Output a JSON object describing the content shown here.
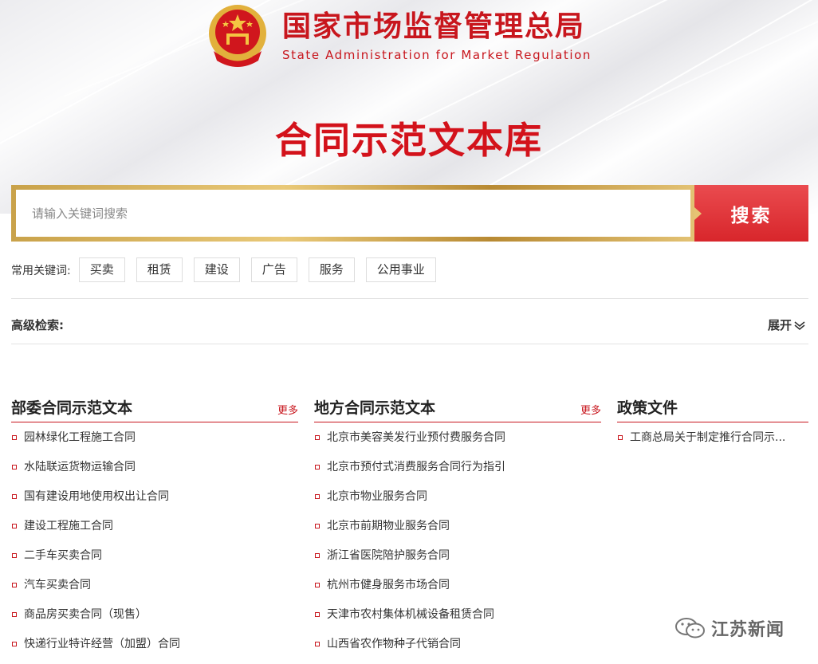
{
  "header": {
    "org_name_cn": "国家市场监督管理总局",
    "org_name_en": "State Administration for Market Regulation",
    "page_title": "合同示范文本库"
  },
  "search": {
    "placeholder": "请输入关键词搜索",
    "button_label": "搜索"
  },
  "keywords": {
    "label": "常用关键词:",
    "tags": [
      "买卖",
      "租赁",
      "建设",
      "广告",
      "服务",
      "公用事业"
    ]
  },
  "advanced": {
    "label": "高级检索:",
    "expand_label": "展开"
  },
  "columns": [
    {
      "title": "部委合同示范文本",
      "more": "更多",
      "items": [
        "园林绿化工程施工合同",
        "水陆联运货物运输合同",
        "国有建设用地使用权出让合同",
        "建设工程施工合同",
        "二手车买卖合同",
        "汽车买卖合同",
        "商品房买卖合同（现售）",
        "快递行业特许经营（加盟）合同"
      ]
    },
    {
      "title": "地方合同示范文本",
      "more": "更多",
      "items": [
        "北京市美容美发行业预付费服务合同",
        "北京市预付式消费服务合同行为指引",
        "北京市物业服务合同",
        "北京市前期物业服务合同",
        "浙江省医院陪护服务合同",
        "杭州市健身服务市场合同",
        "天津市农村集体机械设备租赁合同",
        "山西省农作物种子代销合同"
      ]
    },
    {
      "title": "政策文件",
      "more": "",
      "items": [
        "工商总局关于制定推行合同示..."
      ]
    }
  ],
  "watermark": "江苏新闻",
  "colors": {
    "brand_red": "#c8161d",
    "gold": "#d4af5a"
  },
  "icons": {
    "emblem": "national-emblem-icon",
    "expand": "chevron-down-icon",
    "watermark": "wechat-icon"
  }
}
